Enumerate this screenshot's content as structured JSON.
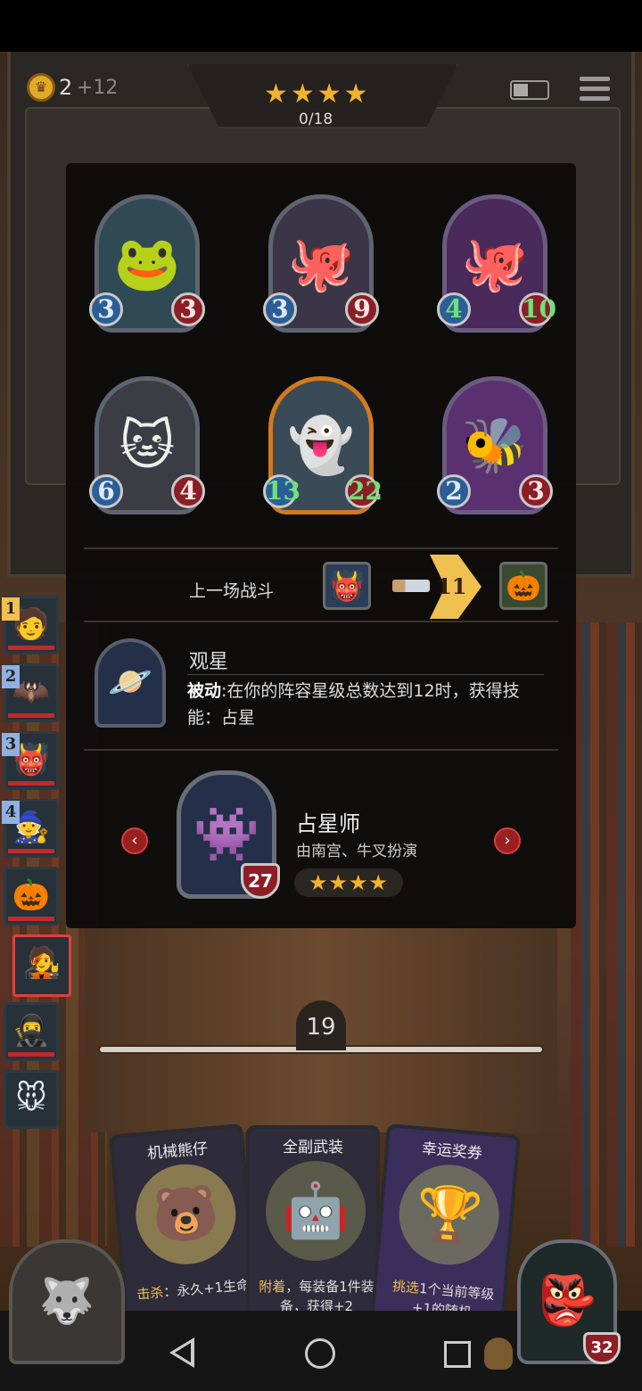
{
  "hud": {
    "gold": "2",
    "gold_income": "+12",
    "stars": "★★★★",
    "progress": "0/18"
  },
  "units": [
    {
      "atk": "3",
      "hp": "3",
      "icon": "blue-toad-icon"
    },
    {
      "atk": "3",
      "hp": "9",
      "icon": "octopus-pirate-icon"
    },
    {
      "atk": "4",
      "hp": "10",
      "icon": "octopus-pirate-purple-icon"
    },
    {
      "atk": "6",
      "hp": "4",
      "icon": "eyepatch-cat-icon"
    },
    {
      "atk": "13",
      "hp": "22",
      "icon": "ghost-lady-icon"
    },
    {
      "atk": "2",
      "hp": "3",
      "icon": "bee-icon"
    }
  ],
  "last_battle": {
    "label": "上一场战斗",
    "damage": "11"
  },
  "ability": {
    "title": "观星",
    "keyword": "被动",
    "desc": ":在你的阵容星级总数达到12时，获得技能：占星"
  },
  "hero": {
    "name": "占星师",
    "cast": "由南宫、牛叉扮演",
    "hp": "27",
    "stars": "★★★★"
  },
  "roster": {
    "ranks": [
      "1",
      "2",
      "3",
      "4"
    ]
  },
  "round": "19",
  "cards": [
    {
      "title": "机械熊仔",
      "keyword": "击杀",
      "text": "：永久+1生命",
      "icon": "mech-bear-icon"
    },
    {
      "title": "全副武装",
      "keyword": "附着",
      "text": "，每装备1件装备，获得+2",
      "icon": "armored-robot-icon"
    },
    {
      "title": "幸运奖券",
      "keyword": "挑选",
      "text": "1个当前等级+1的随机",
      "icon": "trophy-ticket-icon"
    }
  ],
  "boss_hp": "32",
  "colors": {
    "gold": "#f2b22a",
    "health": "#8c1e26",
    "attack": "#2c5e96",
    "accent_red": "#c02a2a"
  }
}
